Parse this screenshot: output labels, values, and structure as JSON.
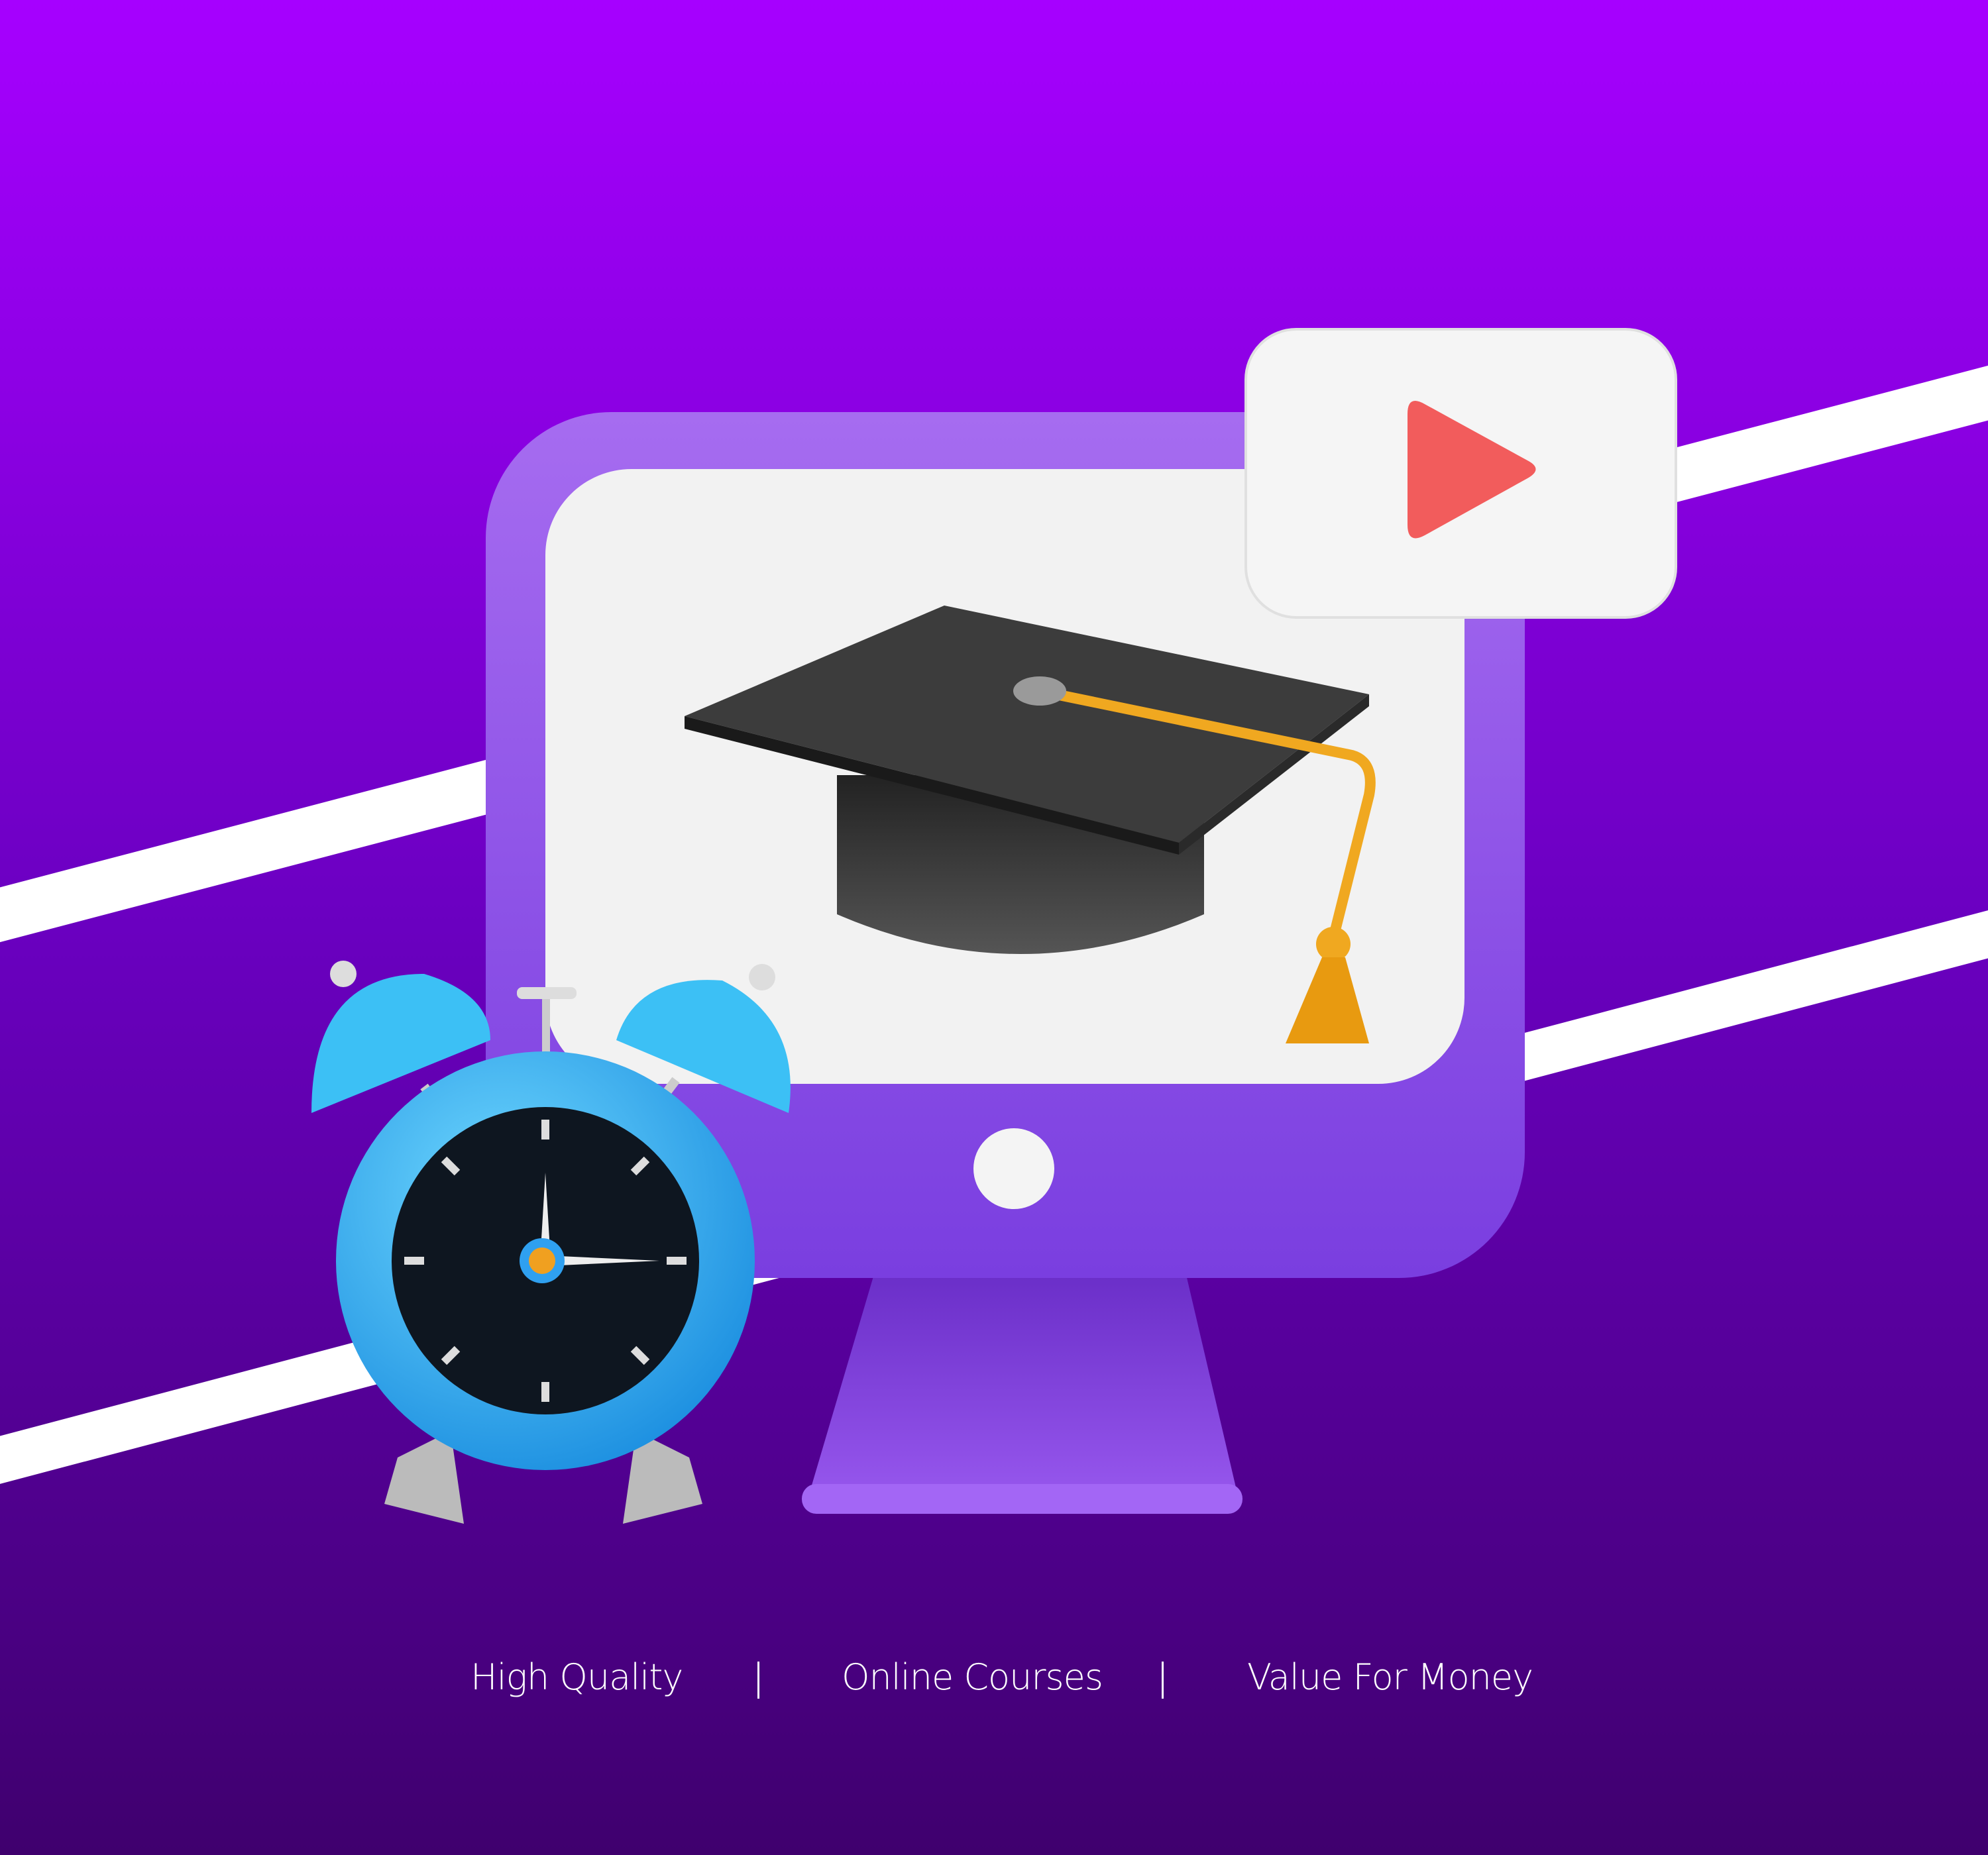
{
  "taglines": {
    "item1": "High Quality",
    "item2": "Online Courses",
    "item3": "Value For Money"
  },
  "colors": {
    "bg_top": "#a600ff",
    "bg_bottom": "#3f006e",
    "monitor": "#8b4ce8",
    "screen": "#f2f2f2",
    "play": "#f25c5c",
    "clock": "#2fb4f0",
    "tassel": "#f0a820"
  }
}
